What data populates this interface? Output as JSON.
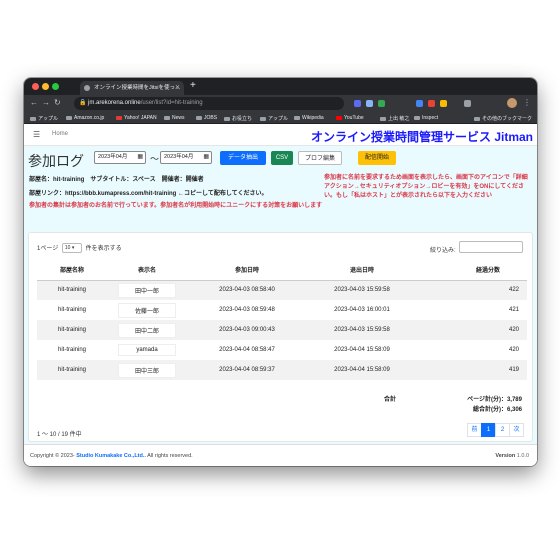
{
  "browser": {
    "tab_title": "オンライン授業時間をJitsiを使っ…",
    "url_host": "jm.arekorena.online",
    "url_path": "/user/list?id=hit-training",
    "bookmarks": [
      "アップル",
      "Amazon.co.jp",
      "Yahoo! JAPAN",
      "News",
      "JOBS",
      "お役立ち",
      "アップル",
      "Wikipedia",
      "YouTube",
      "上出 敏之",
      "Inspect",
      "その他のブックマーク"
    ]
  },
  "header": {
    "home_link": "Home",
    "brand": "オンライン授業時間管理サービス Jitman"
  },
  "main": {
    "title": "参加ログ",
    "date_from": "2023年04月",
    "date_to": "2023年04月",
    "tilde": "〜",
    "buttons": {
      "extract": "データ抽出",
      "csv": "CSV",
      "profile": "プロフ編集",
      "stream": "配信開始"
    },
    "info_line1": "部屋名：hit-training　サブタイトル：スペース　開催者：開催者",
    "info_line2": "部屋リンク：https://bbb.kumapress.com/hit-training ←コピーして配布してください。",
    "warn_left": "参加者の集計は参加者のお名前で行っています。参加者名が利用開始時にユニークにする対策をお願いします",
    "warn_right": "参加者に名前を要求するため画面を表示したら、画面下のアイコンで「詳細アクション→セキュリティオプション→ロビーを有効」をONにしてください。もし「私はホスト」とが表示されたら以下を入力ください"
  },
  "table": {
    "length_prefix": "1ページ",
    "length_value": "10",
    "length_suffix": "件を表示する",
    "search_label": "絞り込み:",
    "columns": [
      "部屋名称",
      "表示名",
      "参加日時",
      "退出日時",
      "経過分数"
    ],
    "rows": [
      [
        "hit-training",
        "田中一郎",
        "2023-04-03 08:58:40",
        "2023-04-03 15:59:58",
        "422"
      ],
      [
        "hit-training",
        "佐藤一郎",
        "2023-04-03 08:59:48",
        "2023-04-03 16:00:01",
        "421"
      ],
      [
        "hit-training",
        "田中二郎",
        "2023-04-03 09:00:43",
        "2023-04-03 15:59:58",
        "420"
      ],
      [
        "hit-training",
        "yamada",
        "2023-04-04 08:58:47",
        "2023-04-04 15:58:09",
        "420"
      ],
      [
        "hit-training",
        "田中三郎",
        "2023-04-04 08:59:37",
        "2023-04-04 15:58:09",
        "419"
      ]
    ],
    "total_label": "合計",
    "page_total": "ページ計(分)：3,789",
    "grand_total": "総合計(分)：6,306",
    "page_info": "1 〜 10 / 19 件中",
    "pager": [
      "前",
      "1",
      "2",
      "次"
    ]
  },
  "footer": {
    "copyright_prefix": "Copyright © 2023-",
    "company": "Studio Kumakake Co.,Ltd..",
    "rights": " All rights reserved.",
    "version_label": "Version",
    "version_value": "1.0.0"
  }
}
